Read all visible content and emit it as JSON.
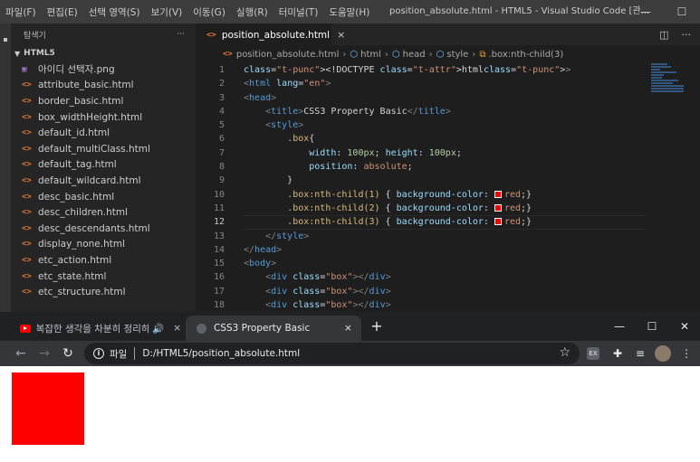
{
  "vscode": {
    "menu": [
      "파일(F)",
      "편집(E)",
      "선택 영역(S)",
      "보기(V)",
      "이동(G)",
      "실행(R)",
      "터미널(T)",
      "도움말(H)"
    ],
    "window_title": "position_absolute.html - HTML5 - Visual Studio Code [관...",
    "sidebar": {
      "header": "탐색기",
      "more": "···",
      "folder": "HTML5",
      "files": [
        {
          "name": "아이디 선택자.png",
          "icon": "image-icon"
        },
        {
          "name": "attribute_basic.html",
          "icon": "html-icon"
        },
        {
          "name": "border_basic.html",
          "icon": "html-icon"
        },
        {
          "name": "box_widthHeight.html",
          "icon": "html-icon"
        },
        {
          "name": "default_id.html",
          "icon": "html-icon"
        },
        {
          "name": "default_multiClass.html",
          "icon": "html-icon"
        },
        {
          "name": "default_tag.html",
          "icon": "html-icon"
        },
        {
          "name": "default_wildcard.html",
          "icon": "html-icon"
        },
        {
          "name": "desc_basic.html",
          "icon": "html-icon"
        },
        {
          "name": "desc_children.html",
          "icon": "html-icon"
        },
        {
          "name": "desc_descendants.html",
          "icon": "html-icon"
        },
        {
          "name": "display_none.html",
          "icon": "html-icon"
        },
        {
          "name": "etc_action.html",
          "icon": "html-icon"
        },
        {
          "name": "etc_state.html",
          "icon": "html-icon"
        },
        {
          "name": "etc_structure.html",
          "icon": "html-icon"
        }
      ]
    },
    "tab": {
      "label": "position_absolute.html",
      "close": "×"
    },
    "breadcrumb": [
      "position_absolute.html",
      "html",
      "head",
      "style",
      ".box:nth-child(3)"
    ],
    "active_line": 12,
    "code_lines": [
      {
        "n": "1",
        "text": "<!DOCTYPE html>"
      },
      {
        "n": "2",
        "text": "<html lang=\"en\">"
      },
      {
        "n": "3",
        "text": "<head>"
      },
      {
        "n": "4",
        "text": "    <title>CSS3 Property Basic</title>"
      },
      {
        "n": "5",
        "text": "    <style>"
      },
      {
        "n": "6",
        "text": "        .box{"
      },
      {
        "n": "7",
        "text": "            width: 100px; height: 100px;"
      },
      {
        "n": "8",
        "text": "            position: absolute;"
      },
      {
        "n": "9",
        "text": "        }"
      },
      {
        "n": "10",
        "text": "        .box:nth-child(1) { background-color: red;}"
      },
      {
        "n": "11",
        "text": "        .box:nth-child(2) { background-color: red;}"
      },
      {
        "n": "12",
        "text": "        .box:nth-child(3) { background-color: red;}"
      },
      {
        "n": "13",
        "text": "    </style>"
      },
      {
        "n": "14",
        "text": "</head>"
      },
      {
        "n": "15",
        "text": "<body>"
      },
      {
        "n": "16",
        "text": "    <div class=\"box\"></div>"
      },
      {
        "n": "17",
        "text": "    <div class=\"box\"></div>"
      },
      {
        "n": "18",
        "text": "    <div class=\"box\"></div>"
      }
    ],
    "color_swatch": "#ff0000"
  },
  "chrome": {
    "tabs": [
      {
        "label": "복잡한 생각을 차분히 정리하",
        "icon": "youtube-icon",
        "audio": "🔊",
        "close": "×"
      },
      {
        "label": "CSS3 Property Basic",
        "icon": "globe-icon",
        "close": "×"
      }
    ],
    "new_tab": "+",
    "omnibox": {
      "scheme_label": "파일",
      "url": "D:/HTML5/position_absolute.html"
    },
    "box_color": "#ff0000"
  }
}
